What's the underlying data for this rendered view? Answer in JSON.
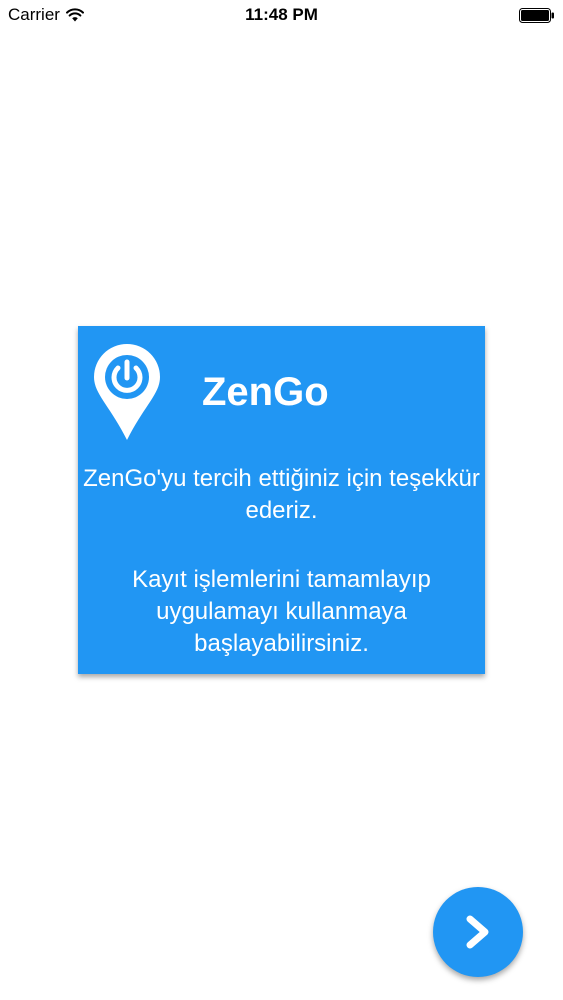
{
  "status_bar": {
    "carrier": "Carrier",
    "time": "11:48 PM"
  },
  "card": {
    "title": "ZenGo",
    "message_1": "ZenGo'yu tercih ettiğiniz için teşekkür ederiz.",
    "message_2": "Kayıt işlemlerini tamamlayıp uygulamayı kullanmaya başlayabilirsiniz.",
    "background_color": "#2196f3",
    "logo_icon": "location-pin-power-icon"
  },
  "next_button": {
    "icon": "chevron-right-icon",
    "color": "#2196f3"
  }
}
